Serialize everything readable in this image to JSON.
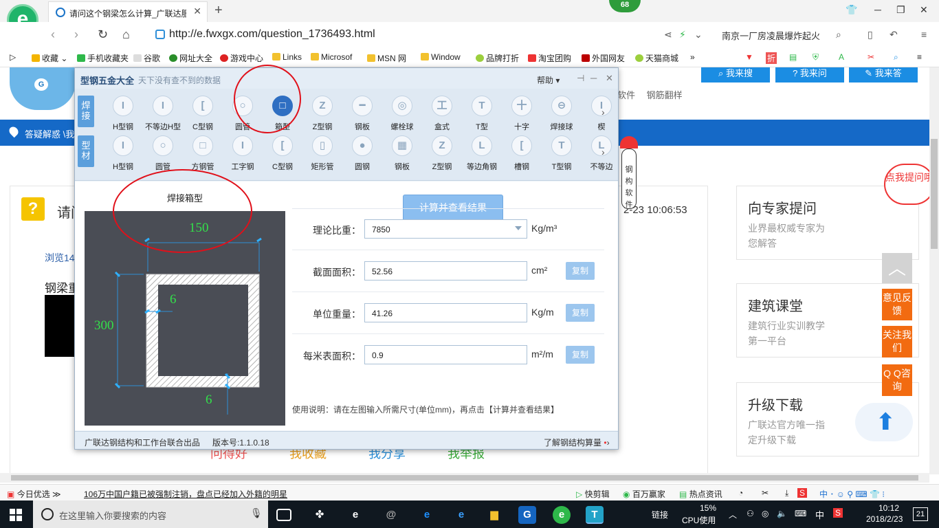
{
  "browser": {
    "tab_title": "请问这个钢梁怎么计算_广联达服",
    "url": "http://e.fwxgx.com/question_1736493.html",
    "news_search": "南京一厂房凌晨爆炸起火",
    "badge_count": "68",
    "favorites": [
      "收藏",
      "手机收藏夹",
      "谷歌",
      "网址大全",
      "游戏中心",
      "Links",
      "Microsof",
      "MSN 网",
      "Window",
      "品牌打折",
      "淘宝团购",
      "外国网友",
      "天猫商城"
    ]
  },
  "page": {
    "top_buttons": [
      "我来搜",
      "我来问",
      "我来答"
    ],
    "subnav": "软件　 钢筋翻样",
    "breadcrumb": "答疑解惑 \\我",
    "question_title": "请问",
    "question_time": "2-23 10:06:53",
    "views": "浏览14",
    "question_body": "钢梁重",
    "actions": [
      "问得好",
      "我收藏",
      "我分享",
      "我举报"
    ],
    "sidebar": [
      {
        "title": "向专家提问",
        "sub": "业界最权威专家为您解答"
      },
      {
        "title": "建筑课堂",
        "sub": "建筑行业实训教学第一平台"
      },
      {
        "title": "升级下载",
        "sub": "广联达官方唯一指定升级下载"
      }
    ],
    "ask_bubble": "点我提问哦",
    "float_buttons": [
      "意见反馈",
      "关注我们",
      "Q Q咨询"
    ]
  },
  "dialog": {
    "title": "型钢五金大全",
    "subtitle": "天下没有查不到的数据",
    "help": "帮助",
    "row1_tag": "焊接",
    "row2_tag": "型材",
    "row1_items": [
      {
        "label": "H型钢",
        "glyph": "I"
      },
      {
        "label": "不等边H型",
        "glyph": "I"
      },
      {
        "label": "C型钢",
        "glyph": "["
      },
      {
        "label": "圆管",
        "glyph": "○"
      },
      {
        "label": "箱型",
        "glyph": "□"
      },
      {
        "label": "Z型钢",
        "glyph": "Z"
      },
      {
        "label": "钢板",
        "glyph": "━"
      },
      {
        "label": "螺栓球",
        "glyph": "◎"
      },
      {
        "label": "盒式",
        "glyph": "工"
      },
      {
        "label": "T型",
        "glyph": "T"
      },
      {
        "label": "十字",
        "glyph": "十"
      },
      {
        "label": "焊接球",
        "glyph": "⊖"
      },
      {
        "label": "楔",
        "glyph": "I"
      }
    ],
    "row2_items": [
      {
        "label": "H型钢",
        "glyph": "I"
      },
      {
        "label": "圆管",
        "glyph": "○"
      },
      {
        "label": "方钢管",
        "glyph": "□"
      },
      {
        "label": "工字钢",
        "glyph": "I"
      },
      {
        "label": "C型钢",
        "glyph": "["
      },
      {
        "label": "矩形管",
        "glyph": "▯"
      },
      {
        "label": "圆钢",
        "glyph": "●"
      },
      {
        "label": "钢板",
        "glyph": "▦"
      },
      {
        "label": "Z型钢",
        "glyph": "Z"
      },
      {
        "label": "等边角钢",
        "glyph": "L"
      },
      {
        "label": "槽钢",
        "glyph": "["
      },
      {
        "label": "T型钢",
        "glyph": "T"
      },
      {
        "label": "不等边",
        "glyph": "L"
      }
    ],
    "section_title": "焊接箱型",
    "dims": {
      "width": "150",
      "height": "300",
      "web_thickness": "6",
      "flange_thickness": "6"
    },
    "calc_button": "计算并查看结果",
    "fields": [
      {
        "label": "理论比重：",
        "value": "7850",
        "unit": "Kg/m³",
        "copy": ""
      },
      {
        "label": "截面面积：",
        "value": "52.56",
        "unit": "cm²",
        "copy": "复制"
      },
      {
        "label": "单位重量：",
        "value": "41.26",
        "unit": "Kg/m",
        "copy": "复制"
      },
      {
        "label": "每米表面积：",
        "value": "0.9",
        "unit": "m²/m",
        "copy": "复制"
      }
    ],
    "usage": "使用说明：请在左图输入所需尺寸(单位mm)，再点击【计算并查看结果】",
    "footer_left": "广联达钢结构和工作台联合出品",
    "footer_version": "版本号:1.1.0.18",
    "footer_right": "了解钢结构算量",
    "mascot_text": "钢构软件"
  },
  "statusbar": {
    "left": "今日优选",
    "news": "106万中国户籍已被强制注销，盘点已经加入外籍的明星",
    "items": [
      "快剪辑",
      "百万赢家",
      "热点资讯"
    ]
  },
  "taskbar": {
    "search_placeholder": "在这里输入你要搜索的内容",
    "link_label": "链接",
    "cpu_percent": "15%",
    "cpu_label": "CPU使用",
    "ime": "中",
    "time": "10:12",
    "date": "2018/2/23",
    "notifications": "21"
  },
  "colors": {
    "accent": "#1b8de3",
    "dialog_selected": "#2f6fc2",
    "dim_text": "#33e04a",
    "annotation": "#e0101a",
    "float_orange": "#f26b11"
  }
}
